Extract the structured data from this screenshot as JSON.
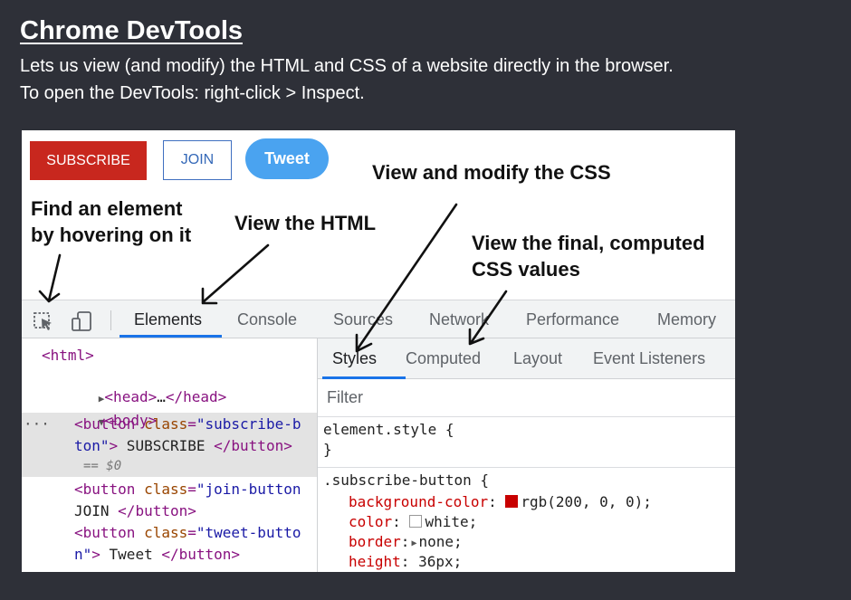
{
  "slide": {
    "title": "Chrome DevTools",
    "line1": "Lets us view (and modify) the HTML and CSS of a website directly in the browser.",
    "line2": "To open the DevTools: right-click > Inspect."
  },
  "demo_buttons": {
    "subscribe": "SUBSCRIBE",
    "join": "JOIN",
    "tweet": "Tweet"
  },
  "annotations": {
    "find_line1": "Find an element",
    "find_line2": "by hovering on it",
    "view_html": "View the HTML",
    "view_css": "View and modify the CSS",
    "computed_line1": "View the final, computed",
    "computed_line2": "CSS values"
  },
  "devtools": {
    "icons": [
      "inspect-element-icon",
      "device-toggle-icon"
    ],
    "tabs": [
      "Elements",
      "Console",
      "Sources",
      "Network",
      "Performance",
      "Memory"
    ],
    "active_tab": "Elements",
    "elements": {
      "l1": "<html>",
      "l2_tag_open": "<head>",
      "l2_ellipsis": "…",
      "l2_tag_close": "</head>",
      "l3": "<body>",
      "dots": "···",
      "sel_marker": "== $0",
      "l4_a": "<button ",
      "l4_attr": "class",
      "l4_eq": "=",
      "l4_val1": "\"subscribe-b",
      "l5_val2": "ton\"",
      "l5_gt": ">",
      "l5_text": " SUBSCRIBE ",
      "l5_close": "</button>",
      "l6_a": "<button ",
      "l6_attr": "class",
      "l6_eq": "=",
      "l6_val": "\"join-button",
      "l7_text": "JOIN ",
      "l7_close": "</button>",
      "l8_a": "<button ",
      "l8_attr": "class",
      "l8_eq": "=",
      "l8_val1": "\"tweet-butto",
      "l9_val2": "n\"",
      "l9_gt": ">",
      "l9_text": " Tweet ",
      "l9_close": "</button>"
    },
    "subtabs": [
      "Styles",
      "Computed",
      "Layout",
      "Event Listeners"
    ],
    "active_subtab": "Styles",
    "filter_placeholder": "Filter",
    "styles": {
      "element_style_open": "element.style {",
      "element_style_close": "}",
      "rule_selector": ".subscribe-button {",
      "props": [
        {
          "name": "background-color",
          "value": "rgb(200, 0, 0);",
          "swatch": "#c80000"
        },
        {
          "name": "color",
          "value": "white;",
          "swatch": "#ffffff"
        },
        {
          "name": "border",
          "value": "none;",
          "expand": "▶"
        },
        {
          "name": "height",
          "value": "36px;"
        }
      ]
    }
  },
  "colors": {
    "slide_bg": "#2e3038",
    "subscribe_red": "#c8271e",
    "join_blue": "#3f6fc0",
    "tweet_blue": "#4aa3f0",
    "devtools_accent": "#1a73e8"
  }
}
